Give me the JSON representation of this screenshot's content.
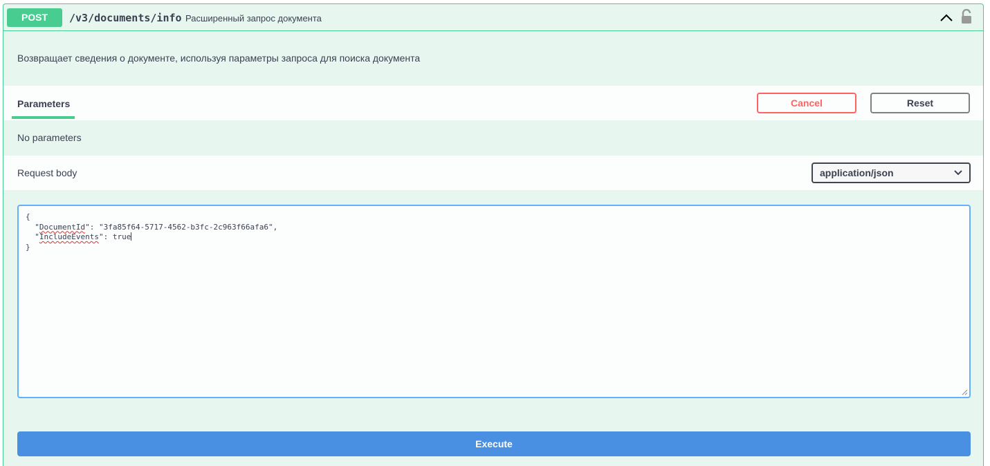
{
  "operation": {
    "method": "POST",
    "path": "/v3/documents/info",
    "summary": "Расширенный запрос документа",
    "description": "Возвращает сведения о документе, используя параметры запроса для поиска документа",
    "method_color": "#49cc90"
  },
  "parameters": {
    "tab_label": "Parameters",
    "cancel_label": "Cancel",
    "reset_label": "Reset",
    "empty_text": "No parameters"
  },
  "request_body": {
    "label": "Request body",
    "content_type": "application/json",
    "editor": {
      "open_brace": "{",
      "line1_key": "DocumentId",
      "line1_value": "\"3fa85f64-5717-4562-b3fc-2c963f66afa6\",",
      "line2_key": "IncludeEvents",
      "line2_value": "true",
      "close_brace": "}"
    }
  },
  "execute_label": "Execute",
  "icons": [
    "chevron-up-icon",
    "lock-icon",
    "chevron-down-icon",
    "resize-handle-icon"
  ]
}
